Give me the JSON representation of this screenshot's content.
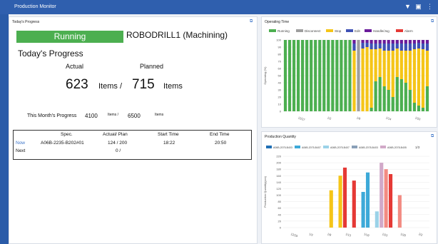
{
  "window": {
    "title": "Production Monitor"
  },
  "progress_panel": {
    "title": "Today's Progress",
    "status": "Running",
    "machine": "ROBODRILL1 (Machining)",
    "heading": "Today's Progress",
    "actual_label": "Actual",
    "planned_label": "Planned",
    "actual_value": "623",
    "items_sep": "Items /",
    "planned_value": "715",
    "items_label": "Items",
    "month_label": "This Month's Progress",
    "month_actual": "4100",
    "month_items_sep": "Items /",
    "month_planned": "6500",
    "month_items": "Items",
    "table": {
      "headers": [
        "Spec.",
        "Actual/ Plan",
        "Start Time",
        "End Time"
      ],
      "rows": [
        {
          "label": "Now",
          "spec": "A06B-2235-B202#01",
          "actual_plan": "124 / 200",
          "start": "18:22",
          "end": "20:50"
        },
        {
          "label": "Next",
          "spec": "",
          "actual_plan": "0 /",
          "start": "",
          "end": ""
        }
      ]
    }
  },
  "operating_panel": {
    "title": "Operating Time"
  },
  "quantity_panel": {
    "title": "Production Quantity",
    "pager": "1/3"
  },
  "colors": {
    "running": "#4caf50",
    "disconnect": "#9e9e9e",
    "stop": "#f5c518",
    "edit": "#3f51b5",
    "handle": "#6a1b9a",
    "alarm": "#e53935"
  },
  "chart_data": [
    {
      "type": "bar",
      "stacked": true,
      "title": "Operating Time",
      "ylabel": "Operating (%)",
      "ylim": [
        0,
        100
      ],
      "yticks": [
        0,
        10,
        20,
        30,
        40,
        50,
        60,
        70,
        80,
        90,
        100
      ],
      "xtick_labels": [
        "12/27",
        "1/2",
        "1/8",
        "1/14",
        "1/20"
      ],
      "legend": [
        "Running",
        "Disconnect",
        "Stop",
        "Edit",
        "Handle/Jog",
        "Alarm"
      ],
      "series": [
        {
          "name": "Running",
          "values": [
            100,
            100,
            100,
            100,
            100,
            100,
            100,
            100,
            100,
            100,
            100,
            100,
            100,
            100,
            100,
            100,
            0,
            0,
            0,
            0,
            5,
            42,
            48,
            35,
            30,
            20,
            48,
            45,
            40,
            30,
            12,
            8,
            5,
            35
          ]
        },
        {
          "name": "Disconnect",
          "values": [
            0,
            0,
            0,
            0,
            0,
            0,
            0,
            0,
            0,
            0,
            0,
            0,
            0,
            0,
            0,
            0,
            0,
            100,
            0,
            0,
            0,
            0,
            0,
            0,
            0,
            0,
            0,
            0,
            0,
            0,
            0,
            0,
            0,
            0
          ]
        },
        {
          "name": "Stop",
          "values": [
            0,
            0,
            0,
            0,
            0,
            0,
            0,
            0,
            0,
            0,
            0,
            0,
            0,
            0,
            0,
            0,
            85,
            0,
            88,
            90,
            82,
            45,
            40,
            50,
            55,
            65,
            40,
            40,
            45,
            55,
            75,
            80,
            82,
            50
          ]
        },
        {
          "name": "Edit",
          "values": [
            0,
            0,
            0,
            0,
            0,
            0,
            0,
            0,
            0,
            0,
            0,
            0,
            0,
            0,
            0,
            0,
            10,
            0,
            8,
            6,
            8,
            8,
            7,
            10,
            10,
            10,
            7,
            10,
            10,
            10,
            8,
            8,
            8,
            10
          ]
        },
        {
          "name": "Handle/Jog",
          "values": [
            0,
            0,
            0,
            0,
            0,
            0,
            0,
            0,
            0,
            0,
            0,
            0,
            0,
            0,
            0,
            0,
            5,
            0,
            4,
            4,
            5,
            5,
            5,
            5,
            5,
            5,
            5,
            5,
            5,
            5,
            5,
            4,
            5,
            5
          ]
        },
        {
          "name": "Alarm",
          "values": [
            0,
            0,
            0,
            0,
            0,
            0,
            0,
            0,
            0,
            0,
            0,
            0,
            0,
            0,
            0,
            0,
            0,
            0,
            0,
            0,
            0,
            0,
            0,
            0,
            0,
            0,
            0,
            0,
            0,
            0,
            0,
            0,
            0,
            0
          ]
        }
      ]
    },
    {
      "type": "bar",
      "stacked": true,
      "title": "Production Quantity",
      "ylabel": "Production Quantity(pcs)",
      "ylim": [
        0,
        220
      ],
      "yticks": [
        0,
        20,
        40,
        60,
        80,
        100,
        120,
        140,
        160,
        180,
        200,
        220
      ],
      "xtick_labels": [
        "12/29",
        "1/3",
        "1/8",
        "1/13",
        "1/18",
        "1/23",
        "1/28",
        "2/2"
      ],
      "legend": [
        "A06B-2075-B403",
        "A06B-2075-B407",
        "A06B-2075-B407",
        "A06B-2078-B403",
        "A06B-2078-B405"
      ],
      "series": [
        {
          "name": "A06B-2075-B403",
          "values": [
            0,
            0,
            0,
            0,
            0,
            0,
            0,
            0,
            0,
            0,
            0,
            0,
            0,
            0,
            0,
            0,
            0,
            0,
            0,
            0,
            0,
            0,
            0,
            0,
            0,
            0,
            0,
            0,
            0,
            0,
            0,
            0
          ]
        },
        {
          "name": "A06B-2075-B407",
          "values": [
            0,
            0,
            0,
            0,
            0,
            0,
            0,
            0,
            0,
            0,
            0,
            0,
            0,
            0,
            0,
            0,
            0,
            0,
            0,
            0,
            0,
            0,
            0,
            0,
            0,
            0,
            0,
            0,
            0,
            0,
            0,
            0
          ]
        },
        {
          "name": "A06B-2075-B407",
          "values": [
            0,
            0,
            0,
            0,
            0,
            0,
            0,
            0,
            0,
            0,
            0,
            0,
            0,
            0,
            0,
            0,
            0,
            0,
            0,
            0,
            0,
            0,
            0,
            0,
            0,
            0,
            0,
            0,
            0,
            0,
            0,
            0
          ]
        },
        {
          "name": "A06B-2078-B403",
          "values": [
            0,
            0,
            0,
            0,
            0,
            0,
            0,
            0,
            0,
            0,
            0,
            0,
            0,
            0,
            0,
            0,
            0,
            0,
            0,
            0,
            0,
            0,
            0,
            0,
            0,
            0,
            0,
            0,
            0,
            0,
            0,
            0
          ]
        },
        {
          "name": "A06B-2078-B405",
          "values": [
            0,
            0,
            0,
            0,
            0,
            0,
            0,
            0,
            0,
            0,
            0,
            0,
            0,
            0,
            0,
            0,
            0,
            0,
            0,
            0,
            0,
            0,
            0,
            0,
            0,
            0,
            0,
            0,
            0,
            0,
            0,
            0
          ]
        }
      ],
      "bars": [
        [
          0,
          0,
          0,
          0
        ],
        [
          0,
          0,
          0,
          0
        ],
        [
          0,
          0,
          0,
          0
        ],
        [
          0,
          0,
          0,
          0
        ],
        [
          0,
          0,
          0,
          0
        ],
        [
          0,
          0,
          0,
          0
        ],
        [
          0,
          0,
          0,
          0
        ],
        [
          0,
          0,
          0,
          0
        ],
        [
          0,
          0,
          0,
          0
        ],
        [
          0,
          0,
          0,
          0
        ],
        [
          115,
          "#f5c518"
        ],
        [
          0,
          ""
        ],
        [
          160,
          "#f5c518"
        ],
        [
          185,
          "#e53935"
        ],
        [
          0,
          ""
        ],
        [
          145,
          "#e53935"
        ],
        [
          0,
          ""
        ],
        [
          110,
          "#3da9d8"
        ],
        [
          170,
          "#3da9d8"
        ],
        [
          0,
          ""
        ],
        [
          50,
          "#9bd2e8"
        ],
        [
          200,
          "#d1a9c8"
        ],
        [
          180,
          "#f28b82"
        ],
        [
          165,
          "#e53935"
        ],
        [
          0,
          ""
        ],
        [
          100,
          "#f28b82"
        ],
        [
          0,
          ""
        ],
        [
          0,
          ""
        ],
        [
          0,
          ""
        ],
        [
          0,
          ""
        ],
        [
          0,
          ""
        ],
        [
          0,
          ""
        ]
      ]
    }
  ]
}
